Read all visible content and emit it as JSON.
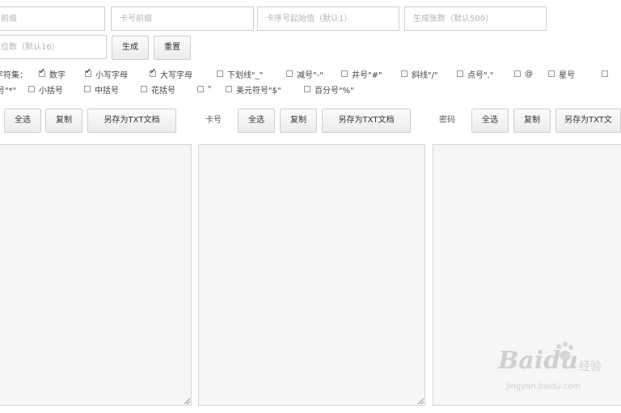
{
  "top_inputs": {
    "field1_placeholder": "前缀",
    "field2_placeholder": "卡号前缀",
    "field3_placeholder": "卡序号起始值（默认1）",
    "field4_placeholder": "生成张数（默认500）",
    "field5_placeholder": "位数（默认16）"
  },
  "actions": {
    "generate_label": "生成",
    "reset_label": "重置"
  },
  "charset": {
    "label": "字符集：",
    "options": [
      {
        "label": "数字",
        "checked": true
      },
      {
        "label": "小写字母",
        "checked": true
      },
      {
        "label": "大写字母",
        "checked": true
      },
      {
        "label": "下划线\"_\"",
        "checked": false
      },
      {
        "label": "减号\"-\"",
        "checked": false
      },
      {
        "label": "井号\"#\"",
        "checked": false
      },
      {
        "label": "斜线\"/\"",
        "checked": false
      },
      {
        "label": "点号\".\"",
        "checked": false
      },
      {
        "label": "@",
        "checked": false
      },
      {
        "label": "星号",
        "checked": false
      },
      {
        "label": "号\"*\"",
        "checked": false
      },
      {
        "label": "小括号",
        "checked": false
      },
      {
        "label": "中括号",
        "checked": false
      },
      {
        "label": "花括号",
        "checked": false
      },
      {
        "label": "\"",
        "checked": false
      },
      {
        "label": "美元符号\"$\"",
        "checked": false
      },
      {
        "label": "百分号\"%\"",
        "checked": false
      }
    ]
  },
  "panels": [
    {
      "title": "",
      "select_all": "全选",
      "copy": "复制",
      "save_txt": "另存为TXT文档"
    },
    {
      "title": "卡号",
      "select_all": "全选",
      "copy": "复制",
      "save_txt": "另存为TXT文档"
    },
    {
      "title": "密码",
      "select_all": "全选",
      "copy": "复制",
      "save_txt": "另存为TXT文"
    }
  ],
  "watermark": {
    "brand": "Baidu",
    "sub": "jingyan.baidu.com",
    "cn": "经验"
  }
}
